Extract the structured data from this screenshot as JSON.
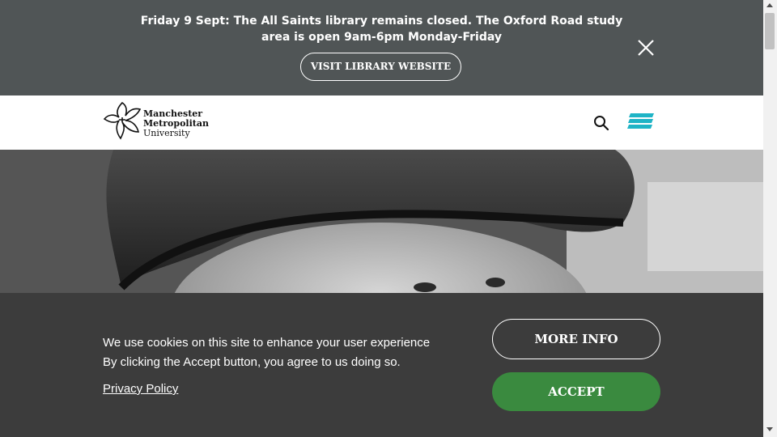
{
  "alert": {
    "message": "Friday 9 Sept: The All Saints library remains closed. The Oxford Road study area is open 9am-6pm Monday-Friday",
    "button_label": "VISIT LIBRARY WEBSITE",
    "close_icon": "close-icon"
  },
  "header": {
    "logo_lines": [
      "Manchester",
      "Metropolitan",
      "University"
    ],
    "search_icon": "search-icon",
    "menu_icon": "hamburger-menu-icon",
    "accent_color": "#1fb4c6"
  },
  "hero": {
    "image_description_icon": "hero-photo"
  },
  "cookie_banner": {
    "line1": "We use cookies on this site to enhance your user experience",
    "line2": "By clicking the Accept button, you agree to us doing so.",
    "privacy_link": "Privacy Policy",
    "more_info_label": "MORE INFO",
    "accept_label": "ACCEPT",
    "accept_color": "#3a8a3f"
  }
}
